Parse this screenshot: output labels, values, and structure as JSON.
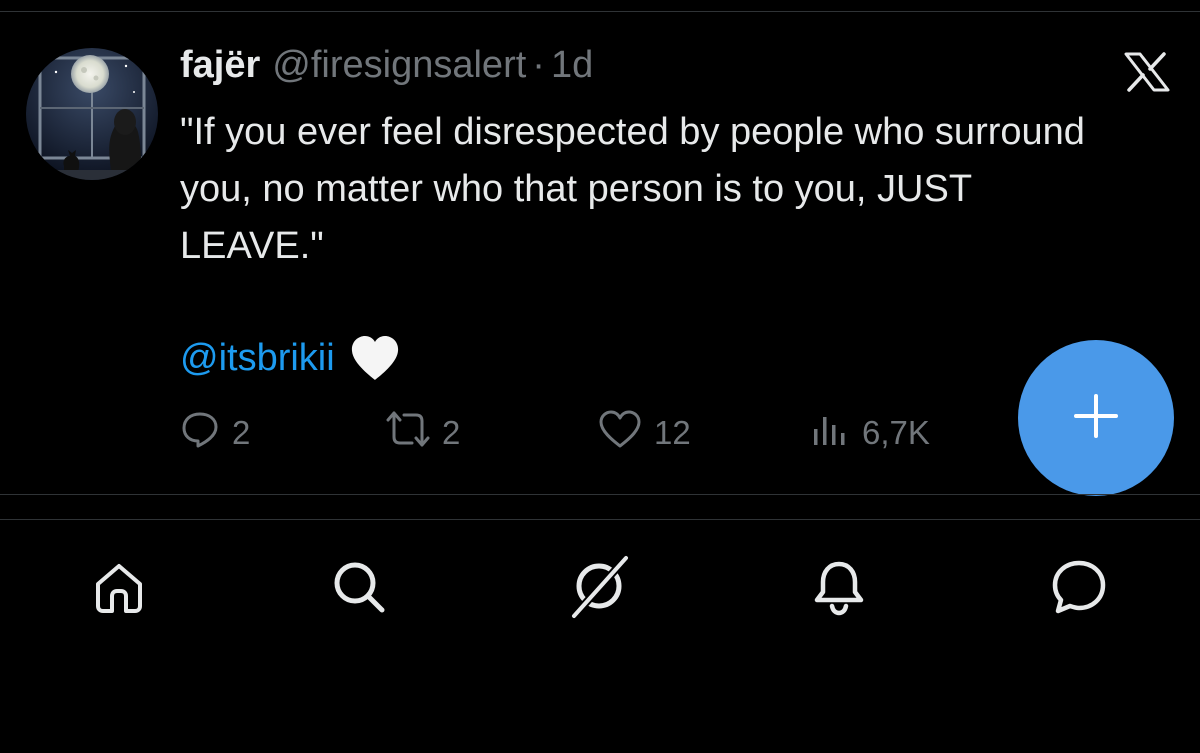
{
  "tweet": {
    "display_name": "fajër",
    "handle": "@firesignsalert",
    "separator": "·",
    "time": "1d",
    "text": "\"If you ever feel disrespected by people who surround you, no matter who that person is to you, JUST LEAVE.\"",
    "mention": "@itsbrikii",
    "emoji": "white-heart"
  },
  "actions": {
    "replies": "2",
    "reposts": "2",
    "likes": "12",
    "views": "6,7K"
  },
  "icons": {
    "app_logo": "x-logo",
    "compose": "plus-icon",
    "nav": [
      "home-icon",
      "search-icon",
      "grok-icon",
      "notifications-icon",
      "messages-icon"
    ]
  },
  "colors": {
    "background": "#000000",
    "text": "#e7e9ea",
    "secondary": "#71767b",
    "link": "#1d9bf0",
    "fab": "#4a99e9"
  }
}
